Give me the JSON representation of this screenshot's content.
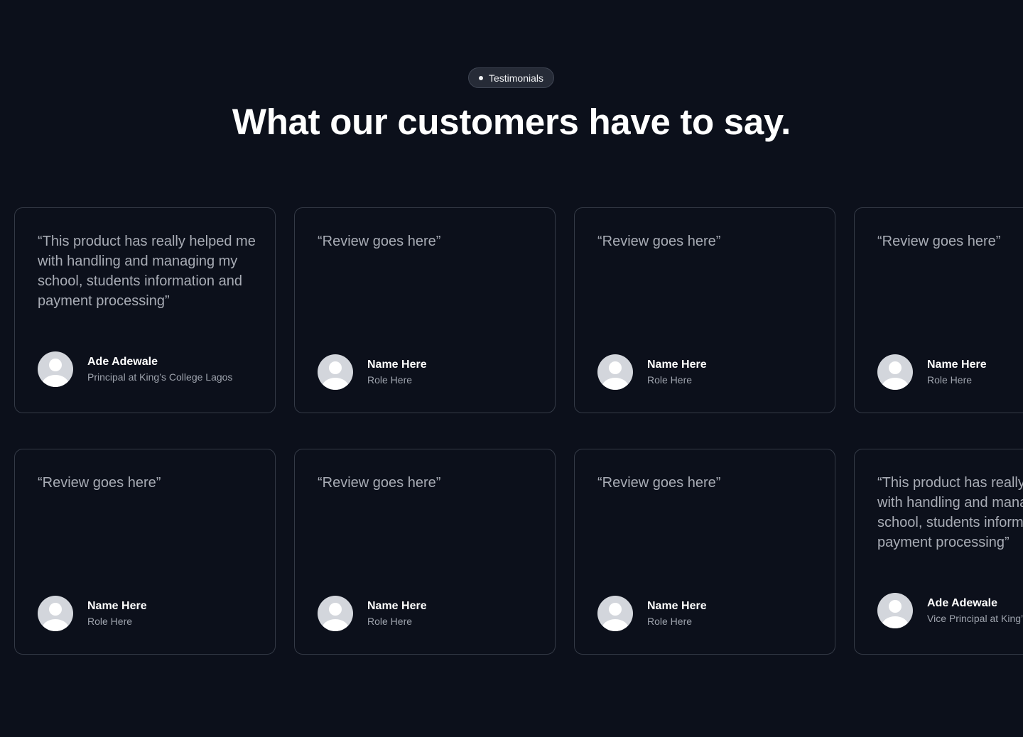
{
  "section": {
    "badge_label": "Testimonials",
    "title": "What our customers have to say."
  },
  "rows": [
    [
      {
        "quote": "“This product has really helped me with handling and managing my school, students information and payment processing”",
        "name": "Ade Adewale",
        "role": "Principal at King’s College Lagos"
      },
      {
        "quote": "“Review goes here”",
        "name": "Name Here",
        "role": "Role Here"
      },
      {
        "quote": "“Review goes here”",
        "name": "Name Here",
        "role": "Role Here"
      },
      {
        "quote": "“Review goes here”",
        "name": "Name Here",
        "role": "Role Here"
      }
    ],
    [
      {
        "quote": "“Review goes here”",
        "name": "Name Here",
        "role": "Role Here"
      },
      {
        "quote": "“Review goes here”",
        "name": "Name Here",
        "role": "Role Here"
      },
      {
        "quote": "“Review goes here”",
        "name": "Name Here",
        "role": "Role Here"
      },
      {
        "quote": "“This product has really helped me with handling and managing my school, students information and payment processing”",
        "name": "Ade Adewale",
        "role": "Vice Principal at King’s College Lagos"
      }
    ]
  ],
  "colors": {
    "background": "#0c101b",
    "card_border": "#343a46",
    "quote_text": "#a8acb5",
    "name_text": "#ffffff",
    "role_text": "#9ea3ad"
  }
}
